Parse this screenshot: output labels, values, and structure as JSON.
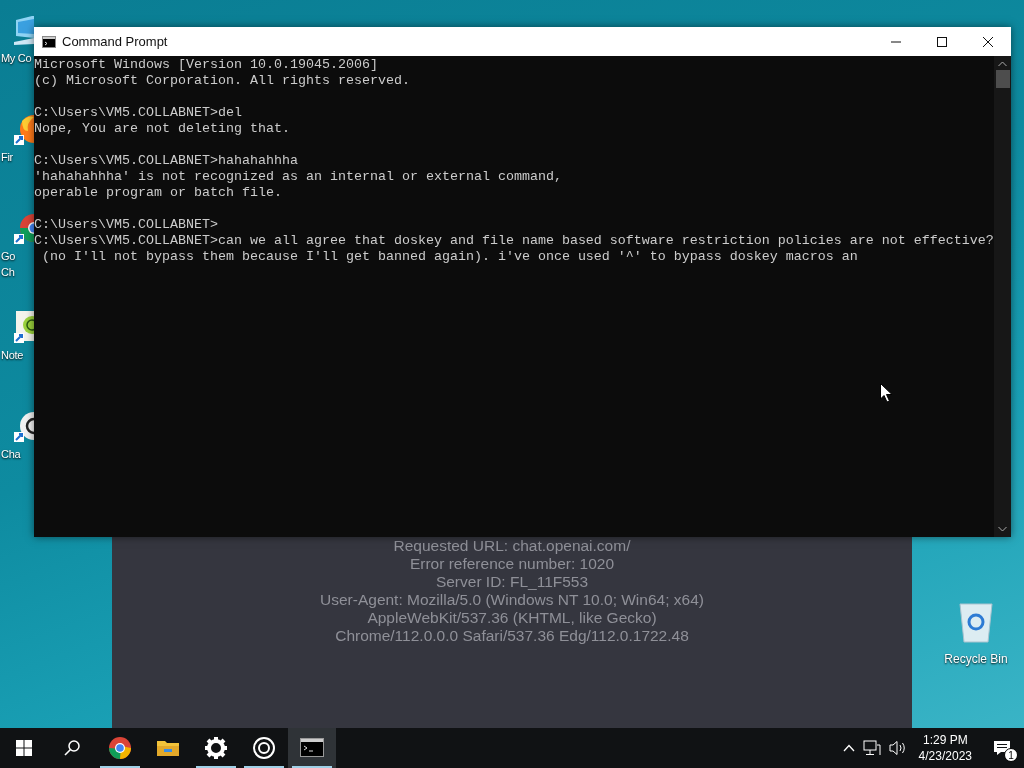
{
  "desktop_icons": [
    {
      "label": "My Co"
    },
    {
      "label": "Fir"
    },
    {
      "label": "Go\nCh"
    },
    {
      "label": "Note"
    },
    {
      "label": "Cha"
    }
  ],
  "recycle_bin": {
    "label": "Recycle Bin"
  },
  "browser_window": {
    "lines": [
      "Requested URL: chat.openai.com/",
      "Error reference number: 1020",
      "Server ID: FL_11F553",
      "User-Agent: Mozilla/5.0 (Windows NT 10.0; Win64; x64)",
      "AppleWebKit/537.36 (KHTML, like Gecko)",
      "Chrome/112.0.0.0 Safari/537.36 Edg/112.0.1722.48"
    ]
  },
  "console_window": {
    "title": "Command Prompt",
    "blocks": [
      [
        "Microsoft Windows [Version 10.0.19045.2006]",
        "(c) Microsoft Corporation. All rights reserved."
      ],
      [
        "C:\\Users\\VM5.COLLABNET>del",
        "Nope, You are not deleting that."
      ],
      [
        "C:\\Users\\VM5.COLLABNET>hahahahhha",
        "'hahahahhha' is not recognized as an internal or external command,",
        "operable program or batch file."
      ],
      [
        "C:\\Users\\VM5.COLLABNET>",
        "C:\\Users\\VM5.COLLABNET>can we all agree that doskey and file name based software restriction policies are not effective?",
        " (no I'll not bypass them because I'll get banned again). i've once used '^' to bypass doskey macros an"
      ]
    ]
  },
  "taskbar": {
    "apps": [
      {
        "running": true,
        "active": false
      },
      {
        "running": false,
        "active": false
      },
      {
        "running": true,
        "active": false
      },
      {
        "running": true,
        "active": false
      },
      {
        "running": true,
        "active": true
      }
    ],
    "tray": {
      "time": "1:29 PM",
      "date": "4/23/2023",
      "notifications": "1"
    }
  }
}
